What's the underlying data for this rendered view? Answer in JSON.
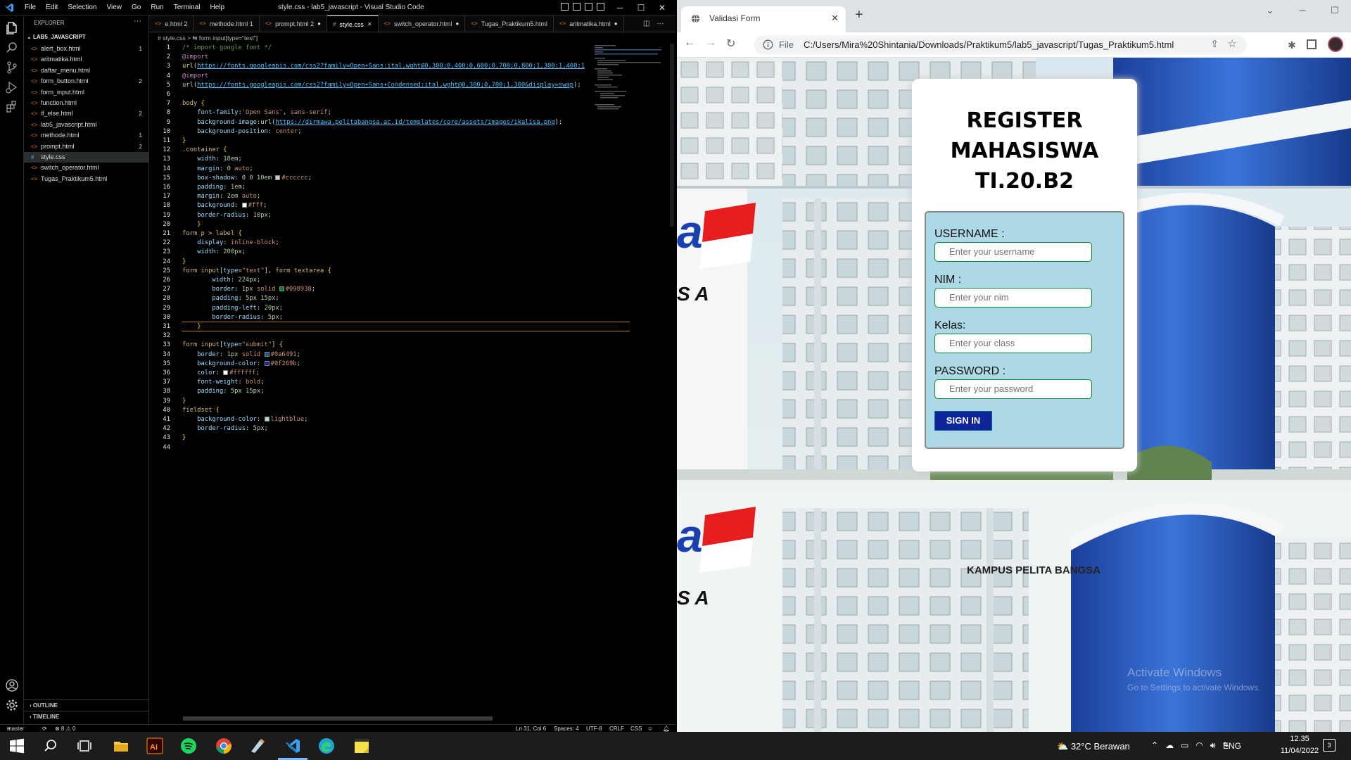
{
  "vscode": {
    "menu": [
      "File",
      "Edit",
      "Selection",
      "View",
      "Go",
      "Run",
      "Terminal",
      "Help"
    ],
    "window_title": "style.css - lab5_javascript - Visual Studio Code",
    "explorer_title": "EXPLORER",
    "root_folder": "LAB5_JAVASCRIPT",
    "files": [
      {
        "name": "alert_box.html",
        "badge": "1",
        "type": "html"
      },
      {
        "name": "aritmatika.html",
        "badge": "",
        "type": "html"
      },
      {
        "name": "daftar_menu.html",
        "badge": "",
        "type": "html"
      },
      {
        "name": "form_button.html",
        "badge": "2",
        "type": "html"
      },
      {
        "name": "form_input.html",
        "badge": "",
        "type": "html"
      },
      {
        "name": "function.html",
        "badge": "",
        "type": "html"
      },
      {
        "name": "if_else.html",
        "badge": "2",
        "type": "html"
      },
      {
        "name": "lab5_javascript.html",
        "badge": "",
        "type": "html"
      },
      {
        "name": "methode.html",
        "badge": "1",
        "type": "html"
      },
      {
        "name": "prompt.html",
        "badge": "2",
        "type": "html"
      },
      {
        "name": "style.css",
        "badge": "",
        "type": "css"
      },
      {
        "name": "switch_operator.html",
        "badge": "",
        "type": "html"
      },
      {
        "name": "Tugas_Praktikum5.html",
        "badge": "",
        "type": "html"
      }
    ],
    "outline_label": "OUTLINE",
    "timeline_label": "TIMELINE",
    "tabs": [
      {
        "label": "e.html 2",
        "type": "html",
        "mark": ""
      },
      {
        "label": "methode.html 1",
        "type": "html",
        "mark": ""
      },
      {
        "label": "prompt.html 2",
        "type": "html",
        "mark": "●"
      },
      {
        "label": "style.css",
        "type": "css",
        "mark": "✕"
      },
      {
        "label": "switch_operator.html",
        "type": "html",
        "mark": "●"
      },
      {
        "label": "Tugas_Praktikum5.html",
        "type": "html",
        "mark": ""
      },
      {
        "label": "aritmatika.html",
        "type": "html",
        "mark": "●"
      }
    ],
    "breadcrumb": "# style.css > ⇆ form input[type=\"text\"]",
    "code_lines": [
      {
        "n": "1",
        "h": "<span class='c'>/* import google font */</span>"
      },
      {
        "n": "2",
        "h": "<span class='at'>@import</span>"
      },
      {
        "n": "3",
        "h": "<span class='f'>url</span>(<span class='u'>https://fonts.googleapis.com/css2?family=Open+Sans:ital,wght@0,300;0,400;0,600;0,700;0,800;1,300;1,400;1</span>"
      },
      {
        "n": "4",
        "h": "<span class='at'>@import</span>"
      },
      {
        "n": "5",
        "h": "<span class='f'>url</span>(<span class='u'>https://fonts.googleapis.com/css2?family=Open+Sans+Condensed:ital,wght@0,300;0,700;1,300&amp;display=swap</span>);"
      },
      {
        "n": "6",
        "h": ""
      },
      {
        "n": "7",
        "h": "<span class='sel'>body</span> <span class='y'>{</span>"
      },
      {
        "n": "8",
        "h": "    <span class='p'>font-family</span>:<span class='s'>'Open Sans'</span>, <span class='s'>sans-serif</span>;"
      },
      {
        "n": "9",
        "h": "    <span class='p'>background-image</span>:<span class='f'>url</span>(<span class='u'>https://dirmawa.pelitabangsa.ac.id/templates/core/assets/images/ikalisa.png</span>);"
      },
      {
        "n": "10",
        "h": "    <span class='p'>background-position</span>: <span class='s'>center</span>;"
      },
      {
        "n": "11",
        "h": "<span class='y'>}</span>"
      },
      {
        "n": "12",
        "h": "<span class='sel'>.container</span> <span class='y'>{</span>"
      },
      {
        "n": "13",
        "h": "    <span class='p'>width</span>: <span class='n'>18em</span>;"
      },
      {
        "n": "14",
        "h": "    <span class='p'>margin</span>: <span class='n'>0</span> <span class='s'>auto</span>;"
      },
      {
        "n": "15",
        "h": "    <span class='p'>box-shadow</span>: <span class='n'>0 0 10em</span> <span class='sw' style='background:#cccccc'></span><span class='s'>#cccccc</span>;"
      },
      {
        "n": "16",
        "h": "    <span class='p'>padding</span>: <span class='n'>1em</span>;"
      },
      {
        "n": "17",
        "h": "    <span class='p'>margin</span>: <span class='n'>2em</span> <span class='s'>auto</span>;"
      },
      {
        "n": "18",
        "h": "    <span class='p'>background</span>: <span class='sw' style='background:#fff'></span><span class='s'>#fff</span>;"
      },
      {
        "n": "19",
        "h": "    <span class='p'>border-radius</span>: <span class='n'>10px</span>;"
      },
      {
        "n": "20",
        "h": "    <span class='y'>}</span>"
      },
      {
        "n": "21",
        "h": "<span class='sel'>form p &gt; label</span> <span class='y'>{</span>"
      },
      {
        "n": "22",
        "h": "    <span class='p'>display</span>: <span class='s'>inline-block</span>;"
      },
      {
        "n": "23",
        "h": "    <span class='p'>width</span>: <span class='n'>200px</span>;"
      },
      {
        "n": "24",
        "h": "<span class='y'>}</span>"
      },
      {
        "n": "25",
        "h": "<span class='sel'>form input</span>[<span class='p'>type</span>=<span class='s'>\"text\"</span>], <span class='sel'>form textarea</span> <span class='y'>{</span>"
      },
      {
        "n": "26",
        "h": "        <span class='p'>width</span>: <span class='n'>224px</span>;"
      },
      {
        "n": "27",
        "h": "        <span class='p'>border</span>: <span class='n'>1px</span> <span class='s'>solid</span> <span class='sw' style='background:#098938'></span><span class='s'>#098938</span>;"
      },
      {
        "n": "28",
        "h": "        <span class='p'>padding</span>: <span class='n'>5px 15px</span>;"
      },
      {
        "n": "29",
        "h": "        <span class='p'>padding-left</span>: <span class='n'>20px</span>;"
      },
      {
        "n": "30",
        "h": "        <span class='p'>border-radius</span>: <span class='n'>5px</span>;"
      },
      {
        "n": "31",
        "h": "    <span class='y'>}</span>"
      },
      {
        "n": "32",
        "h": ""
      },
      {
        "n": "33",
        "h": "<span class='sel'>form input</span>[<span class='p'>type</span>=<span class='s'>\"submit\"</span>] <span class='y'>{</span>"
      },
      {
        "n": "34",
        "h": "    <span class='p'>border</span>: <span class='n'>1px</span> <span class='s'>solid</span> <span class='sw' style='background:#0a6491'></span><span class='s'>#0a6491</span>;"
      },
      {
        "n": "35",
        "h": "    <span class='p'>background-color</span>: <span class='sw' style='background:#0f269b'></span><span class='s'>#0f269b</span>;"
      },
      {
        "n": "36",
        "h": "    <span class='p'>color</span>: <span class='sw' style='background:#ffffff'></span><span class='s'>#ffffff</span>;"
      },
      {
        "n": "37",
        "h": "    <span class='p'>font-weight</span>: <span class='s'>bold</span>;"
      },
      {
        "n": "38",
        "h": "    <span class='p'>padding</span>: <span class='n'>5px 15px</span>;"
      },
      {
        "n": "39",
        "h": "<span class='y'>}</span>"
      },
      {
        "n": "40",
        "h": "<span class='sel'>fieldset</span> <span class='y'>{</span>"
      },
      {
        "n": "41",
        "h": "    <span class='p'>background-color</span>: <span class='sw' style='background:lightblue'></span><span class='s'>lightblue</span>;"
      },
      {
        "n": "42",
        "h": "    <span class='p'>border-radius</span>: <span class='n'>5px</span>;"
      },
      {
        "n": "43",
        "h": "<span class='y'>}</span>"
      },
      {
        "n": "44",
        "h": ""
      }
    ],
    "status": {
      "branch": "master",
      "problems": "⊗ 8 ⚠ 0",
      "position": "Ln 31, Col 6",
      "spaces": "Spaces: 4",
      "encoding": "UTF-8",
      "eol": "CRLF",
      "language": "CSS"
    }
  },
  "browser": {
    "tab_title": "Validasi Form",
    "file_label": "File",
    "url": "C:/Users/Mira%20Shintania/Downloads/Praktikum5/lab5_javascript/Tugas_Praktikum5.html",
    "page": {
      "title_lines": [
        "REGISTER",
        "MAHASISWA",
        "TI.20.B2"
      ],
      "fields": [
        {
          "label": "USERNAME :",
          "placeholder": "Enter your username"
        },
        {
          "label": "NIM :",
          "placeholder": "Enter your nim"
        },
        {
          "label": "Kelas:",
          "placeholder": "Enter your class"
        },
        {
          "label": "PASSWORD :",
          "placeholder": "Enter your password"
        }
      ],
      "submit_label": "SIGN IN",
      "campus_caption": "KAMPUS PELITA BANGSA",
      "watermark_title": "Activate Windows",
      "watermark_sub": "Go to Settings to activate Windows."
    }
  },
  "taskbar": {
    "weather": "32°C  Berawan",
    "language": "ENG",
    "time": "12.35",
    "date": "11/04/2022",
    "notification_count": "3"
  },
  "colors": {
    "fieldset_bg": "lightblue",
    "input_border": "#098938",
    "submit_bg": "#0f269b",
    "submit_border": "#0a6491",
    "container_shadow": "#cccccc"
  }
}
